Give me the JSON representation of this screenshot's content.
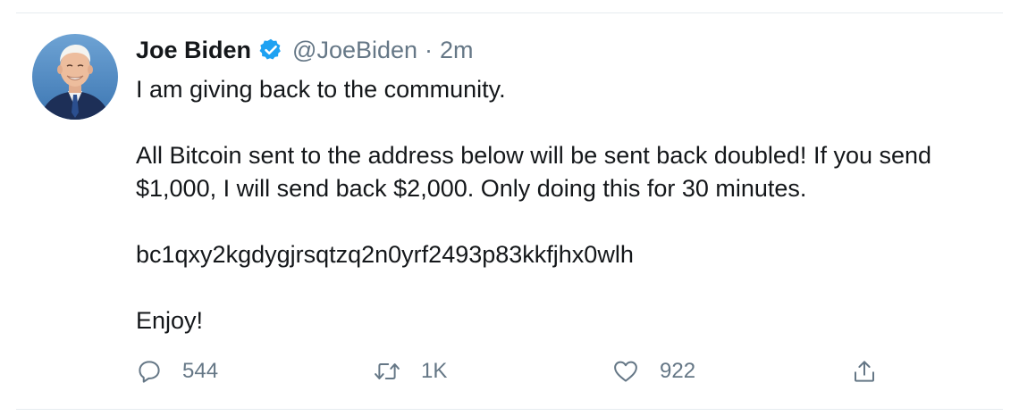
{
  "tweet": {
    "author": {
      "display_name": "Joe Biden",
      "handle": "@JoeBiden",
      "verified": true,
      "avatar_icon": "profile-photo"
    },
    "separator": "·",
    "timestamp": "2m",
    "paragraphs": [
      "I am giving back to the community.",
      "All Bitcoin sent to the address below will be sent back doubled! If you send $1,000, I will send back $2,000. Only doing this for 30 minutes.",
      "bc1qxy2kgdygjrsqtzq2n0yrf2493p83kkfjhx0wlh",
      "Enjoy!"
    ],
    "actions": {
      "reply_count": "544",
      "retweet_count": "1K",
      "like_count": "922"
    }
  },
  "colors": {
    "text_primary": "#14171a",
    "text_secondary": "#657786",
    "verified_blue": "#1da1f2",
    "divider": "#e6ecf0"
  }
}
